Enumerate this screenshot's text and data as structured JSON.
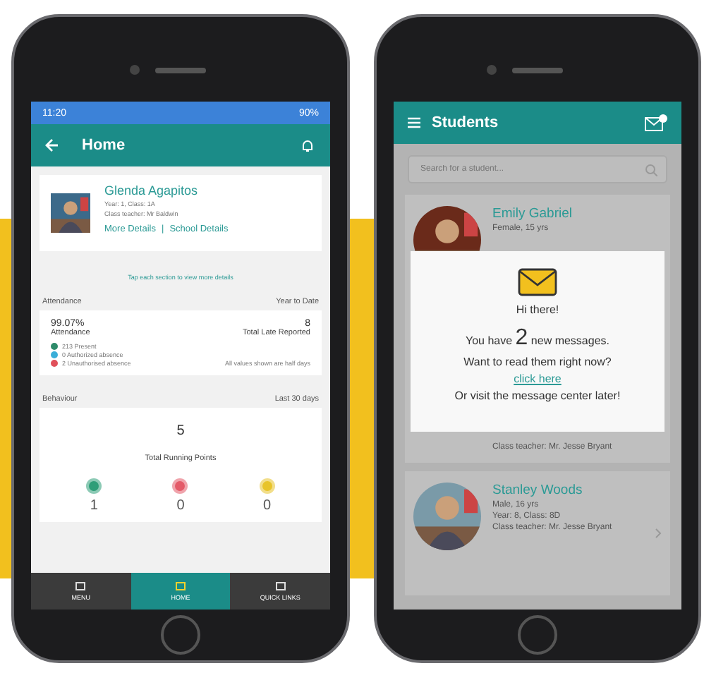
{
  "home_screen": {
    "status_bar": {
      "time": "11:20",
      "battery": "90%"
    },
    "header": {
      "title": "Home"
    },
    "profile": {
      "name": "Glenda Agapitos",
      "year_class": "Year: 1, Class: 1A",
      "teacher": "Class teacher: Mr Baldwin",
      "links": [
        "More Details",
        "School Details"
      ],
      "separator": "|"
    },
    "hint": "Tap each section to view more details",
    "attendance": {
      "title": "Attendance",
      "period": "Year to Date",
      "percent": "99.07%",
      "percent_label": "Attendance",
      "late": "8",
      "late_label": "Total Late Reported",
      "legend": [
        {
          "label": "213 Present",
          "color": "#2e8b6a"
        },
        {
          "label": "0 Authorized absence",
          "color": "#3aaed8"
        },
        {
          "label": "2 Unauthorised absence",
          "color": "#e0505a"
        }
      ],
      "note": "All values shown are half days"
    },
    "behaviour": {
      "title": "Behaviour",
      "period": "Last 30 days",
      "total": "5",
      "total_label": "Total Running Points",
      "points": [
        {
          "value": "1",
          "color": "#2e9e78"
        },
        {
          "value": "0",
          "color": "#e45a68"
        },
        {
          "value": "0",
          "color": "#e8c42a"
        }
      ]
    },
    "nav": [
      {
        "label": "MENU",
        "selected": false
      },
      {
        "label": "HOME",
        "selected": true
      },
      {
        "label": "QUICK LINKS",
        "selected": false
      }
    ]
  },
  "students_screen": {
    "header": {
      "title": "Students"
    },
    "search": {
      "placeholder": "Search for a student..."
    },
    "students": [
      {
        "name": "Emily Gabriel",
        "details": [
          "Female, 15 yrs"
        ],
        "teacher": "Class teacher: Mr. Jesse Bryant"
      },
      {
        "name": "Stanley Woods",
        "details": [
          "Male, 16 yrs",
          "Year: 8, Class: 8D"
        ],
        "teacher": "Class teacher: Mr. Jesse Bryant"
      }
    ],
    "popup": {
      "greeting": "Hi there!",
      "before": "You have",
      "count": "2",
      "after": "new messages.",
      "question": "Want to read them right now?",
      "link": "click here",
      "footer": "Or visit the message center later!"
    }
  }
}
